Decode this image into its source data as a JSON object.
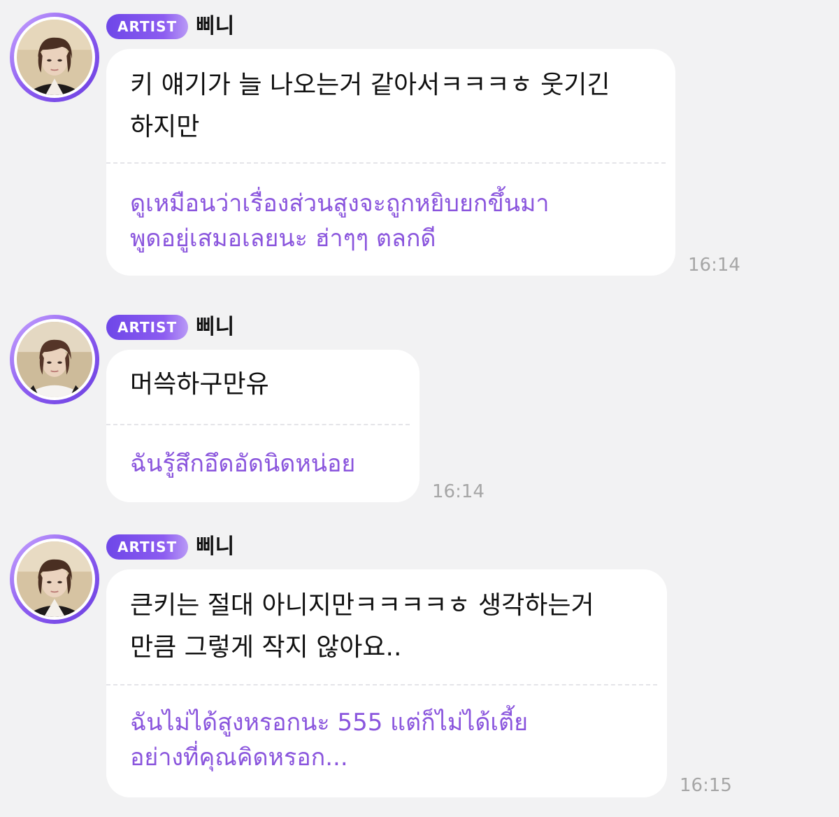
{
  "messages": [
    {
      "badge": "ARTIST",
      "nickname": "삐니",
      "original": "키 얘기가 늘 나오는거 같아서ㅋㅋㅋㅎ 웃기긴\n하지만",
      "translation": "ดูเหมือนว่าเรื่องส่วนสูงจะถูกหยิบยกขึ้นมา\nพูดอยู่เสมอเลยนะ ฮ่าๆๆ ตลกดี",
      "time": "16:14"
    },
    {
      "badge": "ARTIST",
      "nickname": "삐니",
      "original": "머쓱하구만유",
      "translation": "ฉันรู้สึกอึดอัดนิดหน่อย",
      "time": "16:14"
    },
    {
      "badge": "ARTIST",
      "nickname": "삐니",
      "original": "큰키는 절대 아니지만ㅋㅋㅋㅋㅎ 생각하는거\n만큼 그렇게 작지 않아요..",
      "translation": "ฉันไม่ได้สูงหรอกนะ 555 แต่ก็ไม่ได้เตี้ย\nอย่างที่คุณคิดหรอก...",
      "time": "16:15"
    }
  ]
}
